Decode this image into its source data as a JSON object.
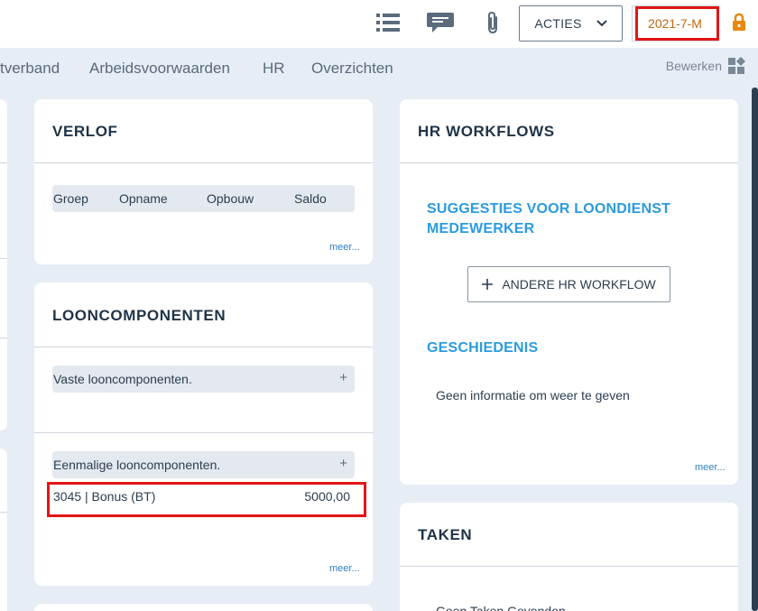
{
  "toolbar": {
    "list_icon": "list-icon",
    "comment_icon": "comment-icon",
    "attachment_icon": "paperclip-icon",
    "acties_label": "ACTIES",
    "period_label": "2021-7-M",
    "lock_icon": "lock-icon",
    "lock_color": "#e8870e"
  },
  "tabs": {
    "items": [
      {
        "label": "tverband"
      },
      {
        "label": "Arbeidsvoorwaarden"
      },
      {
        "label": "HR"
      },
      {
        "label": "Overzichten"
      }
    ],
    "edit_label": "Bewerken"
  },
  "verlof": {
    "title": "VERLOF",
    "columns": [
      "Groep",
      "Opname",
      "Opbouw",
      "Saldo"
    ],
    "more": "meer..."
  },
  "looncomponenten": {
    "title": "LOONCOMPONENTEN",
    "fixed_label": "Vaste looncomponenten.",
    "onetime_label": "Eenmalige looncomponenten.",
    "add_symbol": "+",
    "row": {
      "name": "3045 | Bonus (BT)",
      "amount": "5000,00"
    },
    "more": "meer..."
  },
  "hr_workflows": {
    "title": "HR WORKFLOWS",
    "suggestions_heading": "SUGGESTIES VOOR LOONDIENST MEDEWERKER",
    "other_button": "ANDERE HR WORKFLOW",
    "history_heading": "GESCHIEDENIS",
    "empty_text": "Geen informatie om weer te geven",
    "more": "meer..."
  },
  "taken": {
    "title": "TAKEN",
    "partial_text": "Geen Taken Gevonden"
  },
  "colors": {
    "accent_blue": "#2a9be0",
    "highlight_red": "#e31515",
    "period_orange": "#c0680f"
  }
}
